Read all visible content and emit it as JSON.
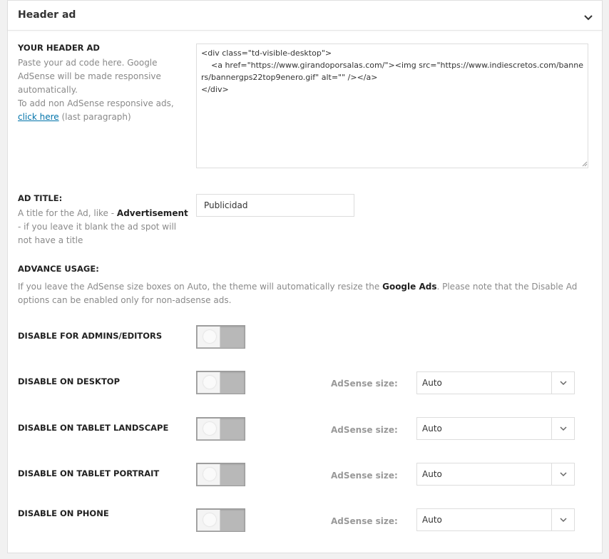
{
  "panel": {
    "title": "Header ad",
    "collapse_icon": "chevron-down-icon"
  },
  "header_ad": {
    "label": "YOUR HEADER AD",
    "desc_line1": "Paste your ad code here. Google AdSense will be made responsive automatically.",
    "desc_line2": "To add non AdSense responsive ads,",
    "desc_link": "click here",
    "desc_after_link": "(last paragraph)",
    "code": "<div class=\"td-visible-desktop\">\n    <a href=\"https://www.girandoporsalas.com/\"><img src=\"https://www.indiescretos.com/banners/bannergps22top9enero.gif\" alt=\"\" /></a>\n</div>"
  },
  "ad_title": {
    "label": "AD TITLE:",
    "desc_before": "A title for the Ad, like -",
    "desc_bold": "Advertisement",
    "desc_after": "- if you leave it blank the ad spot will not have a title",
    "value": "Publicidad"
  },
  "advance": {
    "label": "ADVANCE USAGE:",
    "desc_before": "If you leave the AdSense size boxes on Auto, the theme will automatically resize the",
    "desc_bold": "Google Ads",
    "desc_after": ". Please note that the Disable Ad options can be enabled only for non-adsense ads."
  },
  "rows": [
    {
      "label": "DISABLE FOR ADMINS/EDITORS",
      "enabled": false
    },
    {
      "label": "DISABLE ON DESKTOP",
      "enabled": false,
      "size_label": "AdSense size:",
      "size_value": "Auto"
    },
    {
      "label": "DISABLE ON TABLET LANDSCAPE",
      "enabled": false,
      "size_label": "AdSense size:",
      "size_value": "Auto"
    },
    {
      "label": "DISABLE ON TABLET PORTRAIT",
      "enabled": false,
      "size_label": "AdSense size:",
      "size_value": "Auto"
    },
    {
      "label": "DISABLE ON PHONE",
      "enabled": false,
      "size_label": "AdSense size:",
      "size_value": "Auto"
    }
  ],
  "colors": {
    "link": "#0073aa",
    "toggle_off": "#b8b8b8"
  }
}
